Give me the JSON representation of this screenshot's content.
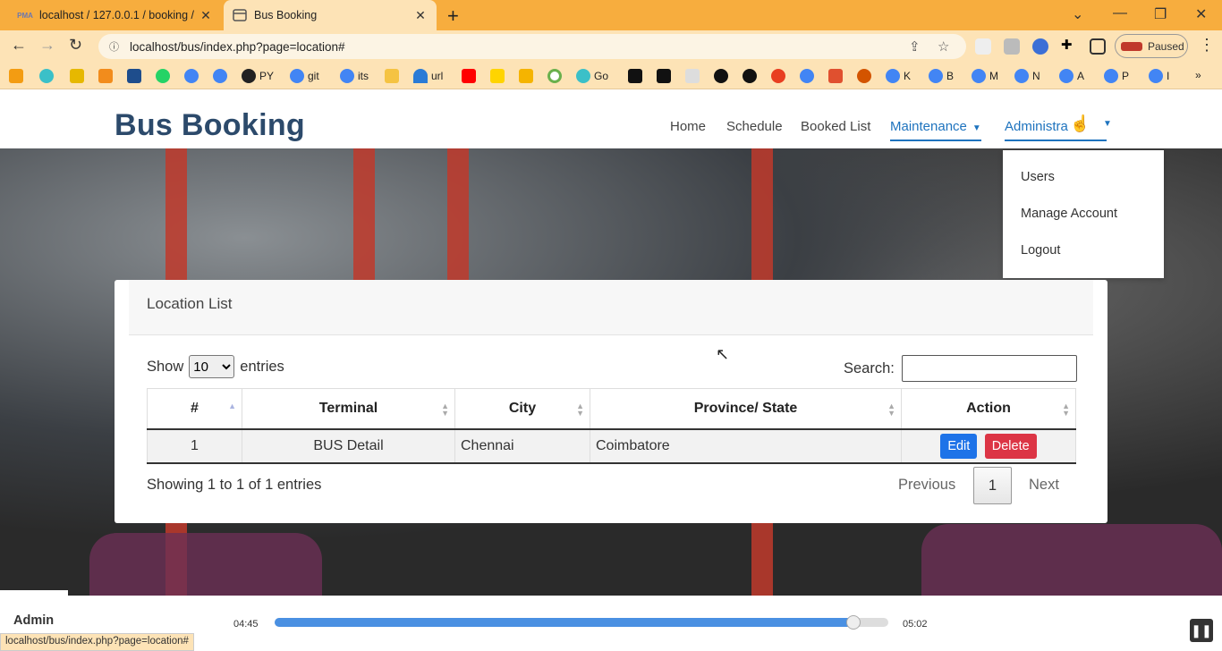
{
  "browser": {
    "tabs": [
      {
        "title": "localhost / 127.0.0.1 / booking /",
        "favicon": "PMA",
        "close": "✕"
      },
      {
        "title": "Bus Booking",
        "favicon": "tab-page-icon",
        "close": "✕"
      }
    ],
    "new_tab": "+",
    "address": "localhost/bus/index.php?page=location#",
    "profile_status": "Paused",
    "bookmarks": [
      "PY",
      "git",
      "its",
      "url",
      "Go",
      "K",
      "B",
      "M",
      "N",
      "A",
      "P",
      "I"
    ],
    "status_url": "localhost/bus/index.php?page=location#"
  },
  "site": {
    "brand": "Bus Booking",
    "nav": [
      {
        "label": "Home"
      },
      {
        "label": "Schedule"
      },
      {
        "label": "Booked List"
      },
      {
        "label": "Maintenance"
      },
      {
        "label": "Administra"
      }
    ],
    "dropdown": [
      "Users",
      "Manage Account",
      "Logout"
    ]
  },
  "card": {
    "title": "Location List",
    "show_label": "Show",
    "entries_label": "entries",
    "entries_value": "10",
    "search_label": "Search:",
    "columns": [
      "#",
      "Terminal",
      "City",
      "Province/ State",
      "Action"
    ],
    "rows": [
      {
        "num": "1",
        "terminal": "BUS Detail",
        "city": "Chennai",
        "province": "Coimbatore",
        "edit": "Edit",
        "delete": "Delete"
      }
    ],
    "info": "Showing 1 to 1 of 1 entries",
    "previous": "Previous",
    "page": "1",
    "next": "Next"
  },
  "overlay": {
    "admin_label": "Admin",
    "player_time_current": "04:45",
    "player_time_total": "05:02",
    "player_progress": 0.943
  },
  "colors": {
    "tabbar": "#f7ad3e",
    "toolbar": "#fde3b6",
    "brand": "#2c4a6b",
    "link_active": "#1e73be",
    "edit_button": "#1e73e8",
    "delete_button": "#dc3545"
  }
}
